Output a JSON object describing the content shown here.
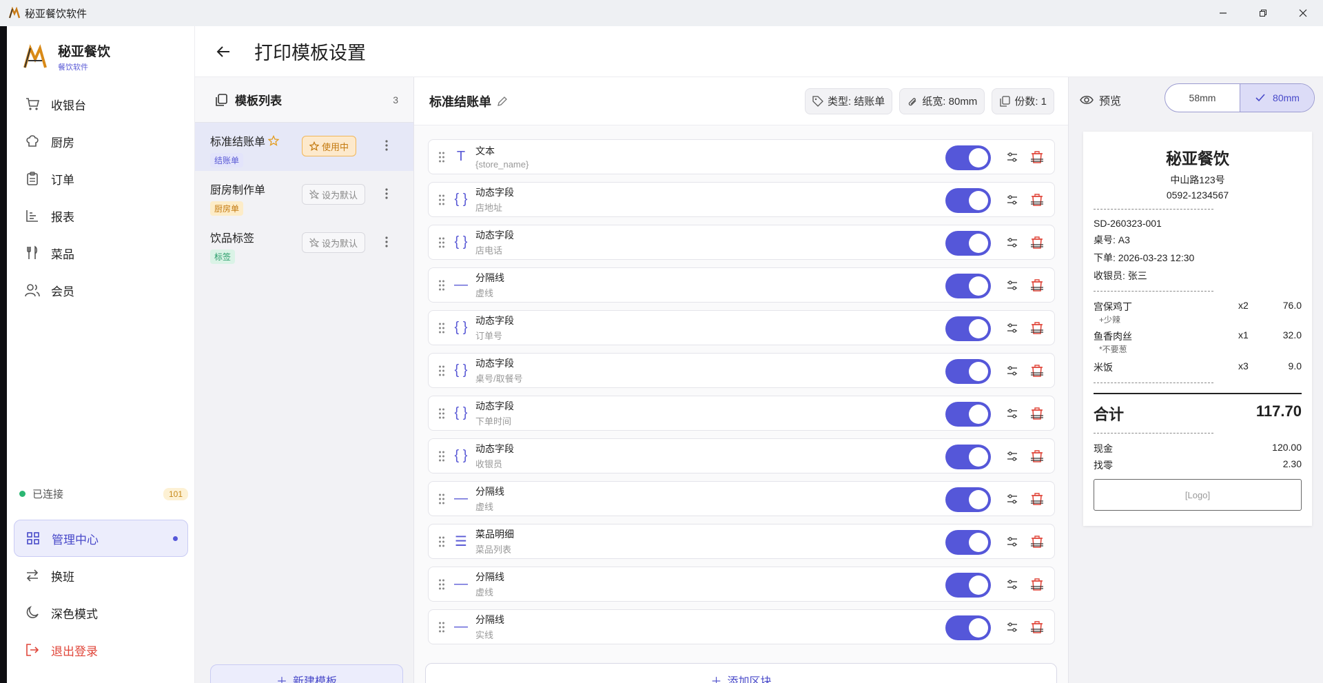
{
  "window": {
    "title": "秘亚餐饮软件"
  },
  "brand": {
    "name": "秘亚餐饮",
    "subtitle": "餐饮软件"
  },
  "nav": {
    "items": [
      {
        "label": "收银台",
        "icon": "cart-icon"
      },
      {
        "label": "厨房",
        "icon": "chef-hat-icon"
      },
      {
        "label": "订单",
        "icon": "clipboard-icon"
      },
      {
        "label": "报表",
        "icon": "bar-chart-icon"
      },
      {
        "label": "菜品",
        "icon": "utensils-icon"
      },
      {
        "label": "会员",
        "icon": "users-icon"
      }
    ]
  },
  "connection": {
    "status": "已连接",
    "badge": "101"
  },
  "bottom_nav": {
    "admin": "管理中心",
    "shift": "换班",
    "dark": "深色模式",
    "logout": "退出登录"
  },
  "page": {
    "title": "打印模板设置"
  },
  "template_list": {
    "title": "模板列表",
    "count": "3",
    "items": [
      {
        "name": "标准结账单",
        "tag": "结账单",
        "tag_color": "#5b5bd6",
        "tag_bg": "#e3e4fb",
        "button": "使用中"
      },
      {
        "name": "厨房制作单",
        "tag": "厨房单",
        "tag_color": "#c47a10",
        "tag_bg": "#fdecc8",
        "button": "设为默认"
      },
      {
        "name": "饮品标签",
        "tag": "标签",
        "tag_color": "#2a9d6a",
        "tag_bg": "#daf3e6",
        "button": "设为默认"
      }
    ],
    "new_button": "新建模板"
  },
  "editor": {
    "title": "标准结账单",
    "chips": {
      "type": "类型: 结账单",
      "paper": "纸宽: 80mm",
      "copies": "份数: 1"
    },
    "blocks": [
      {
        "label": "文本",
        "sub": "{store_name}",
        "icon": "T"
      },
      {
        "label": "动态字段",
        "sub": "店地址",
        "icon": "{ }"
      },
      {
        "label": "动态字段",
        "sub": "店电话",
        "icon": "{ }"
      },
      {
        "label": "分隔线",
        "sub": "虚线",
        "icon": "—"
      },
      {
        "label": "动态字段",
        "sub": "订单号",
        "icon": "{ }"
      },
      {
        "label": "动态字段",
        "sub": "桌号/取餐号",
        "icon": "{ }"
      },
      {
        "label": "动态字段",
        "sub": "下单时间",
        "icon": "{ }"
      },
      {
        "label": "动态字段",
        "sub": "收银员",
        "icon": "{ }"
      },
      {
        "label": "分隔线",
        "sub": "虚线",
        "icon": "—"
      },
      {
        "label": "菜品明细",
        "sub": "菜品列表",
        "icon": "☰"
      },
      {
        "label": "分隔线",
        "sub": "虚线",
        "icon": "—"
      },
      {
        "label": "分隔线",
        "sub": "实线",
        "icon": "—"
      }
    ],
    "add_button": "添加区块"
  },
  "preview": {
    "label": "预览",
    "sizes": [
      "58mm",
      "80mm"
    ],
    "selected": "80mm"
  },
  "receipt": {
    "store": "秘亚餐饮",
    "address": "中山路123号",
    "phone": "0592-1234567",
    "order_no": "SD-260323-001",
    "table": "桌号: A3",
    "time": "下单: 2026-03-23 12:30",
    "cashier": "收银员: 张三",
    "items": [
      {
        "name": "宫保鸡丁",
        "qty": "x2",
        "price": "76.0",
        "note": "+少辣"
      },
      {
        "name": "鱼香肉丝",
        "qty": "x1",
        "price": "32.0",
        "note": "*不要葱"
      },
      {
        "name": "米饭",
        "qty": "x3",
        "price": "9.0",
        "note": ""
      }
    ],
    "total_label": "合计",
    "total": "117.70",
    "cash_label": "现金",
    "cash": "120.00",
    "change_label": "找零",
    "change": "2.30",
    "logo": "[Logo]"
  },
  "colors": {
    "accent": "#5557d9",
    "danger": "#e0463a",
    "success": "#2bb673"
  }
}
